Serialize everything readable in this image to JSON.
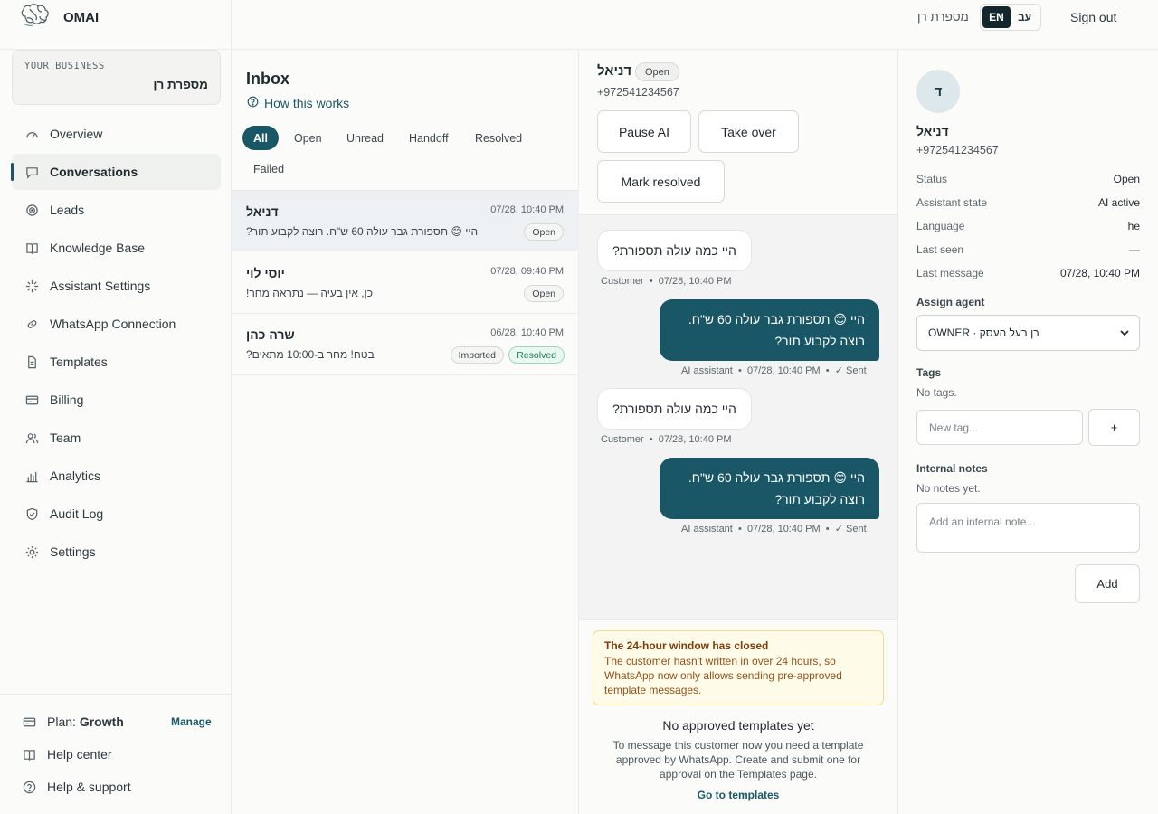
{
  "app": {
    "name": "OMAI",
    "brand_icon": "brain-logo-icon",
    "accent_color": "#1a5766"
  },
  "topbar": {
    "business_name": "מספרת רן",
    "languages": [
      "EN",
      "עב"
    ],
    "active_language": "EN",
    "sign_out": "Sign out"
  },
  "sidebar": {
    "business_label": "YOUR BUSINESS",
    "business_name": "מספרת רן",
    "items": [
      {
        "label": "Overview",
        "icon": "gauge-icon"
      },
      {
        "label": "Conversations",
        "icon": "chat-bubble-icon",
        "active": true
      },
      {
        "label": "Leads",
        "icon": "target-icon"
      },
      {
        "label": "Knowledge Base",
        "icon": "book-icon"
      },
      {
        "label": "Assistant Settings",
        "icon": "sparkle-icon"
      },
      {
        "label": "WhatsApp Connection",
        "icon": "link-icon"
      },
      {
        "label": "Templates",
        "icon": "document-icon"
      },
      {
        "label": "Billing",
        "icon": "credit-card-icon"
      },
      {
        "label": "Team",
        "icon": "users-icon"
      },
      {
        "label": "Analytics",
        "icon": "bar-chart-icon"
      },
      {
        "label": "Audit Log",
        "icon": "shield-icon"
      },
      {
        "label": "Settings",
        "icon": "gear-icon"
      }
    ],
    "plan_prefix": "Plan:",
    "plan_name": "Growth",
    "manage": "Manage",
    "help_center": "Help center",
    "help_support": "Help & support"
  },
  "inbox": {
    "title": "Inbox",
    "how_link": "How this works",
    "filters": [
      "All",
      "Open",
      "Unread",
      "Handoff",
      "Resolved",
      "Failed"
    ],
    "active_filter": "All",
    "conversations": [
      {
        "name": "דניאל",
        "time": "07/28, 10:40 PM",
        "preview": "היי 😊 תספורת גבר עולה 60 ש\"ח. רוצה לקבוע תור?",
        "badges": [
          "Open"
        ]
      },
      {
        "name": "יוסי לוי",
        "time": "07/28, 09:40 PM",
        "preview": "כן, אין בעיה — נתראה מחר!",
        "badges": [
          "Open"
        ]
      },
      {
        "name": "שרה כהן",
        "time": "06/28, 10:40 PM",
        "preview": "בטח! מחר ב-10:00 מתאים?",
        "badges": [
          "Imported",
          "Resolved"
        ]
      }
    ]
  },
  "chat": {
    "name": "דניאל",
    "status": "Open",
    "phone": "+972541234567",
    "actions": {
      "pause": "Pause AI",
      "takeover": "Take over",
      "resolve": "Mark resolved"
    },
    "messages": [
      {
        "dir": "in",
        "text": "היי כמה עולה תספורת?",
        "sender": "Customer",
        "time": "07/28, 10:40 PM"
      },
      {
        "dir": "out",
        "line1": "היי 😊 תספורת גבר עולה 60 ש\"ח.",
        "line2": "רוצה לקבוע תור?",
        "sender": "AI assistant",
        "time": "07/28, 10:40 PM",
        "status": "Sent"
      },
      {
        "dir": "in",
        "text": "היי כמה עולה תספורת?",
        "sender": "Customer",
        "time": "07/28, 10:40 PM"
      },
      {
        "dir": "out",
        "line1": "היי 😊 תספורת גבר עולה 60 ש\"ח.",
        "line2": "רוצה לקבוע תור?",
        "sender": "AI assistant",
        "time": "07/28, 10:40 PM",
        "status": "Sent"
      }
    ],
    "window_notice": {
      "title": "The 24-hour window has closed",
      "body": "The customer hasn't written in over 24 hours, so WhatsApp now only allows sending pre-approved template messages."
    },
    "no_templates": {
      "title": "No approved templates yet",
      "body": "To message this customer now you need a template approved by WhatsApp. Create and submit one for approval on the Templates page.",
      "link": "Go to templates"
    }
  },
  "details": {
    "avatar_letter": "ד",
    "name": "דניאל",
    "phone": "+972541234567",
    "fields": [
      {
        "label": "Status",
        "value": "Open"
      },
      {
        "label": "Assistant state",
        "value": "AI active"
      },
      {
        "label": "Language",
        "value": "he"
      },
      {
        "label": "Last seen",
        "value": "—"
      },
      {
        "label": "Last message",
        "value": "07/28, 10:40 PM"
      }
    ],
    "assign_label": "Assign agent",
    "assign_value": "רן בעל העסק · OWNER",
    "tags_label": "Tags",
    "tags_empty": "No tags.",
    "tag_placeholder": "New tag...",
    "tag_add": "+",
    "notes_label": "Internal notes",
    "notes_empty": "No notes yet.",
    "note_placeholder": "Add an internal note...",
    "note_add": "Add"
  }
}
